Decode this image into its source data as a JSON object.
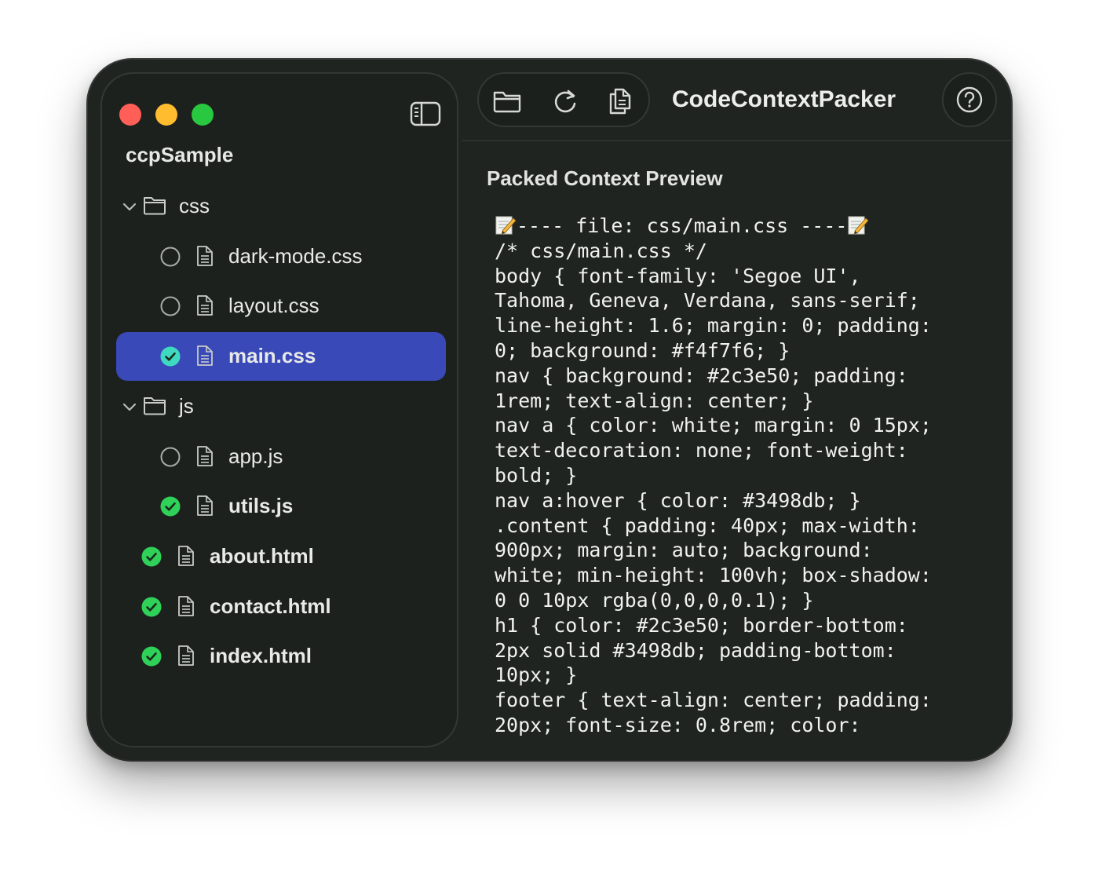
{
  "sidebar": {
    "project_name": "ccpSample",
    "tree": [
      {
        "type": "folder",
        "name": "css"
      },
      {
        "type": "file",
        "name": "dark-mode.css",
        "checked": false,
        "selected": false,
        "indent": 1
      },
      {
        "type": "file",
        "name": "layout.css",
        "checked": false,
        "selected": false,
        "indent": 1
      },
      {
        "type": "file",
        "name": "main.css",
        "checked": true,
        "selected": true,
        "indent": 1
      },
      {
        "type": "folder",
        "name": "js"
      },
      {
        "type": "file",
        "name": "app.js",
        "checked": false,
        "selected": false,
        "indent": 1
      },
      {
        "type": "file",
        "name": "utils.js",
        "checked": true,
        "selected": false,
        "indent": 1
      },
      {
        "type": "file",
        "name": "about.html",
        "checked": true,
        "selected": false,
        "indent": 0
      },
      {
        "type": "file",
        "name": "contact.html",
        "checked": true,
        "selected": false,
        "indent": 0
      },
      {
        "type": "file",
        "name": "index.html",
        "checked": true,
        "selected": false,
        "indent": 0
      }
    ]
  },
  "toolbar": {
    "app_title": "CodeContextPacker",
    "icons": [
      "folder-icon",
      "refresh-icon",
      "copy-icon",
      "help-icon"
    ]
  },
  "preview": {
    "heading": "Packed Context Preview",
    "header_line": "---- file: css/main.css ----",
    "lines": [
      "/* css/main.css */",
      "body { font-family: 'Segoe UI',",
      "Tahoma, Geneva, Verdana, sans-serif;",
      "line-height: 1.6; margin: 0; padding:",
      "0; background: #f4f7f6; }",
      "nav { background: #2c3e50; padding:",
      "1rem; text-align: center; }",
      "nav a { color: white; margin: 0 15px;",
      "text-decoration: none; font-weight:",
      "bold; }",
      "nav a:hover { color: #3498db; }",
      ".content { padding: 40px; max-width:",
      "900px; margin: auto; background:",
      "white; min-height: 100vh; box-shadow:",
      "0 0 10px rgba(0,0,0,0.1); }",
      "h1 { color: #2c3e50; border-bottom:",
      "2px solid #3498db; padding-bottom:",
      "10px; }",
      "footer { text-align: center; padding:",
      "20px; font-size: 0.8rem; color:"
    ]
  },
  "colors": {
    "window_bg": "#1f2420",
    "selection": "#3a49b8",
    "check_green": "#30d158",
    "check_teal": "#3fd9c0",
    "close": "#ff5f57",
    "minimize": "#febc2e",
    "zoom": "#28c840"
  }
}
